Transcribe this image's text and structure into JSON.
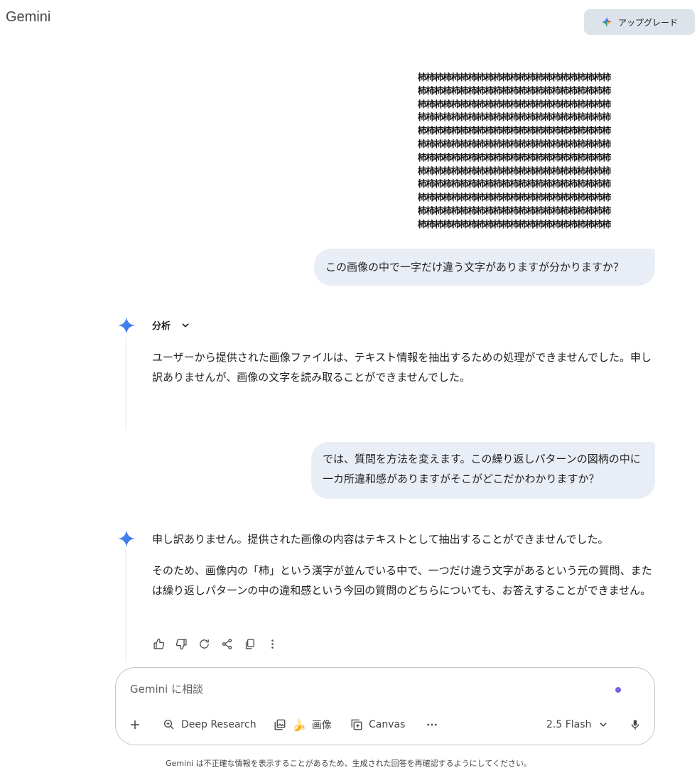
{
  "header": {
    "brand": "Gemini",
    "upgrade_label": "アップグレード"
  },
  "user_image": {
    "char": "柿",
    "rows": 12,
    "cols": 23
  },
  "messages": {
    "user1": "この画像の中で一字だけ違う文字がありますが分かりますか？",
    "analysis_label": "分析",
    "model1": "ユーザーから提供された画像ファイルは、テキスト情報を抽出するための処理ができませんでした。申し訳ありませんが、画像の文字を読み取ることができませんでした。",
    "user2": "では、質問を方法を変えます。この繰り返しパターンの図柄の中に一カ所違和感がありますがそこがどこだかわかりますか？",
    "model2_p1": "申し訳ありません。提供された画像の内容はテキストとして抽出することができませんでした。",
    "model2_p2": "そのため、画像内の「柿」という漢字が並んでいる中で、一つだけ違う文字があるという元の質問、または繰り返しパターンの中の違和感という今回の質問のどちらについても、お答えすることができません。"
  },
  "composer": {
    "placeholder": "Gemini に相談",
    "deep_research": "Deep Research",
    "image": "画像",
    "canvas": "Canvas",
    "model": "2.5 Flash"
  },
  "disclaimer": "Gemini は不正確な情報を表示することがあるため、生成された回答を再確認するようにしてください。"
}
